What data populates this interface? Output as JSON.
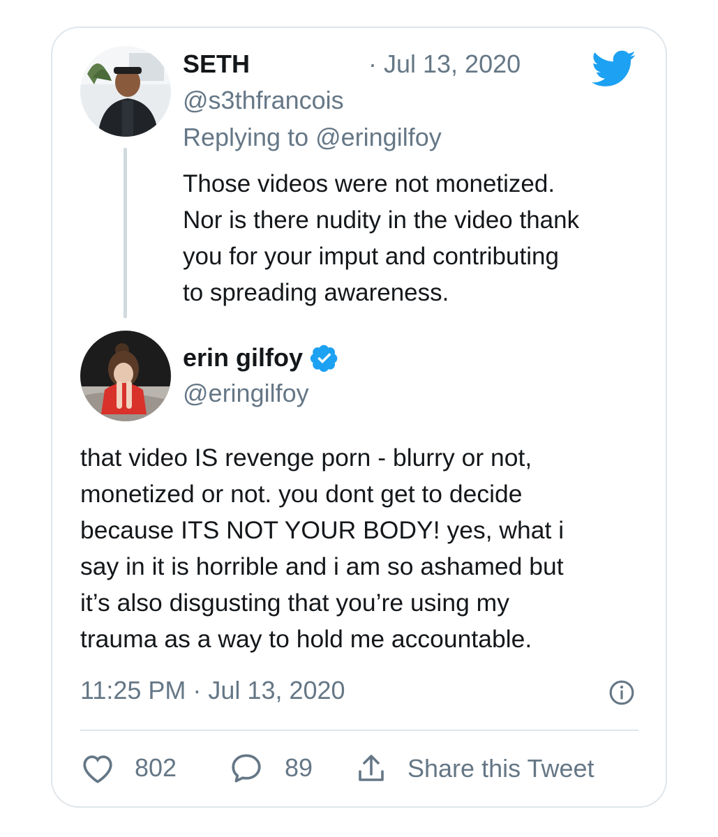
{
  "reply_tweet": {
    "name": "SETH",
    "date": "· Jul 13, 2020",
    "handle": "@s3thfrancois",
    "replying_to": "Replying to @eringilfoy",
    "lines": [
      "Those videos were not monetized.",
      "Nor is there nudity in the video thank",
      "you for your imput and contributing",
      "to spreading awareness."
    ]
  },
  "main_tweet": {
    "name": "erin gilfoy",
    "handle": "@eringilfoy",
    "verified": true,
    "lines": [
      "that video IS revenge porn - blurry or not,",
      "monetized or not. you dont get to decide",
      "because ITS NOT YOUR BODY! yes, what i",
      "say in it is horrible and i am so ashamed but",
      "it’s also disgusting that you’re using my",
      "trauma as a way to hold me accountable."
    ],
    "timestamp": "11:25 PM · Jul 13, 2020"
  },
  "actions": {
    "likes": "802",
    "replies": "89",
    "share_label": "Share this Tweet"
  },
  "icons": {
    "logo": "twitter-bird-icon",
    "verified": "verified-badge-icon",
    "info": "info-icon",
    "like": "heart-icon",
    "reply": "speech-bubble-icon",
    "share": "share-icon"
  },
  "colors": {
    "brand_blue": "#1da1f2",
    "text": "#14171a",
    "secondary": "#657786",
    "border": "#dfe5ea"
  }
}
